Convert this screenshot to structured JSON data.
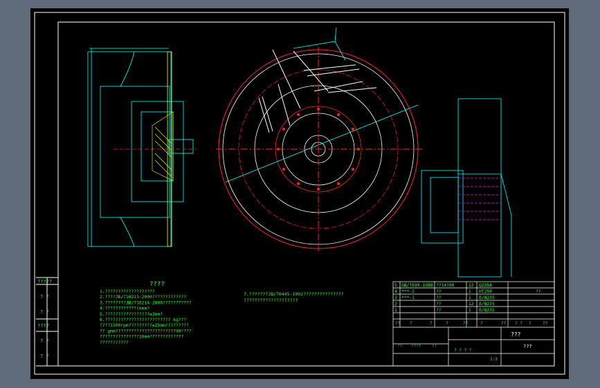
{
  "colors": {
    "background": "#5f6b78",
    "canvas": "#000000",
    "frame": "#ffffff",
    "outline": "#00ffff",
    "text": "#33ff33",
    "centerline": "#ff2222",
    "hatch": "#ffff00",
    "part": "#ff00ff"
  },
  "left_strip": [
    "?????",
    "? ?",
    "? ?",
    "????",
    "? ?",
    "? ?"
  ],
  "notes": {
    "title": "????",
    "lines": [
      "1.???????????????????",
      "2.????JB/T10213-2000?????????????",
      "3.????????JB/T10214-2000???????????",
      "4.????????????(kmm?",
      "5.?????????????????≤3mm?",
      "6.?????????????????????????      kg???",
      "????1500rpm?????????≤25mm?????????",
      "??  gmm???????????????????????90°???",
      "???????????????10mm?????????????",
      "???????????"
    ],
    "line7": "7.???????JB/T6445-1992???????????????",
    "line7b": "????????????????????"
  },
  "bom": {
    "rows": [
      {
        "no": "5",
        "code": "GB/T699-1988",
        "name": "??14?60",
        "qty": "12",
        "material": "Q235A",
        "note": ""
      },
      {
        "no": "4",
        "code": "***-2",
        "name": "??",
        "qty": "1",
        "material": "HT250",
        "note": "??"
      },
      {
        "no": "3",
        "code": "***-1",
        "name": "??",
        "qty": "1",
        "material": "δ/Q235",
        "note": ""
      },
      {
        "no": "2",
        "code": "",
        "name": "??",
        "qty": "12",
        "material": "δ/Q235",
        "note": ""
      },
      {
        "no": "1",
        "code": "",
        "name": "??",
        "qty": "1",
        "material": "δ/Q235",
        "note": ""
      }
    ],
    "header": [
      "??",
      "?",
      "?",
      "?",
      "??",
      "?",
      "??",
      "? ?",
      "?",
      "??"
    ]
  },
  "title_block": {
    "title": "???",
    "drawing_no": "???",
    "scale_labels": "? ? ? ?",
    "sign_labels": [
      "??",
      "????",
      "??"
    ],
    "sheet": "1:3"
  }
}
